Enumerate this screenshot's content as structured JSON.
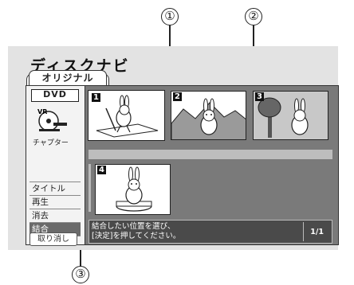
{
  "callouts": [
    "①",
    "②",
    "③"
  ],
  "screen": {
    "title": "ディスクナビ",
    "tab_label": "オリジナル",
    "disc_badge": "DVD",
    "disc_icon_label": "VR",
    "chapter_label": "チャプター"
  },
  "menu": {
    "items": [
      "タイトル",
      "再生",
      "消去",
      "結合"
    ],
    "selected": "結合",
    "cancel_label": "取り消し"
  },
  "thumbnails": [
    {
      "number": "1",
      "scene": "bunny-golf"
    },
    {
      "number": "2",
      "scene": "bunny-mountains"
    },
    {
      "number": "3",
      "scene": "bunny-tree"
    },
    {
      "number": "4",
      "scene": "bunny-stage"
    }
  ],
  "message": {
    "line1": "結合したい位置を選び、",
    "line2": "[決定]を押してください。",
    "page": "1/1"
  },
  "colors": {
    "content_bg": "#7a7a7a",
    "selected_menu_bg": "#6a6a6a",
    "message_bg": "#4a4a4a"
  }
}
